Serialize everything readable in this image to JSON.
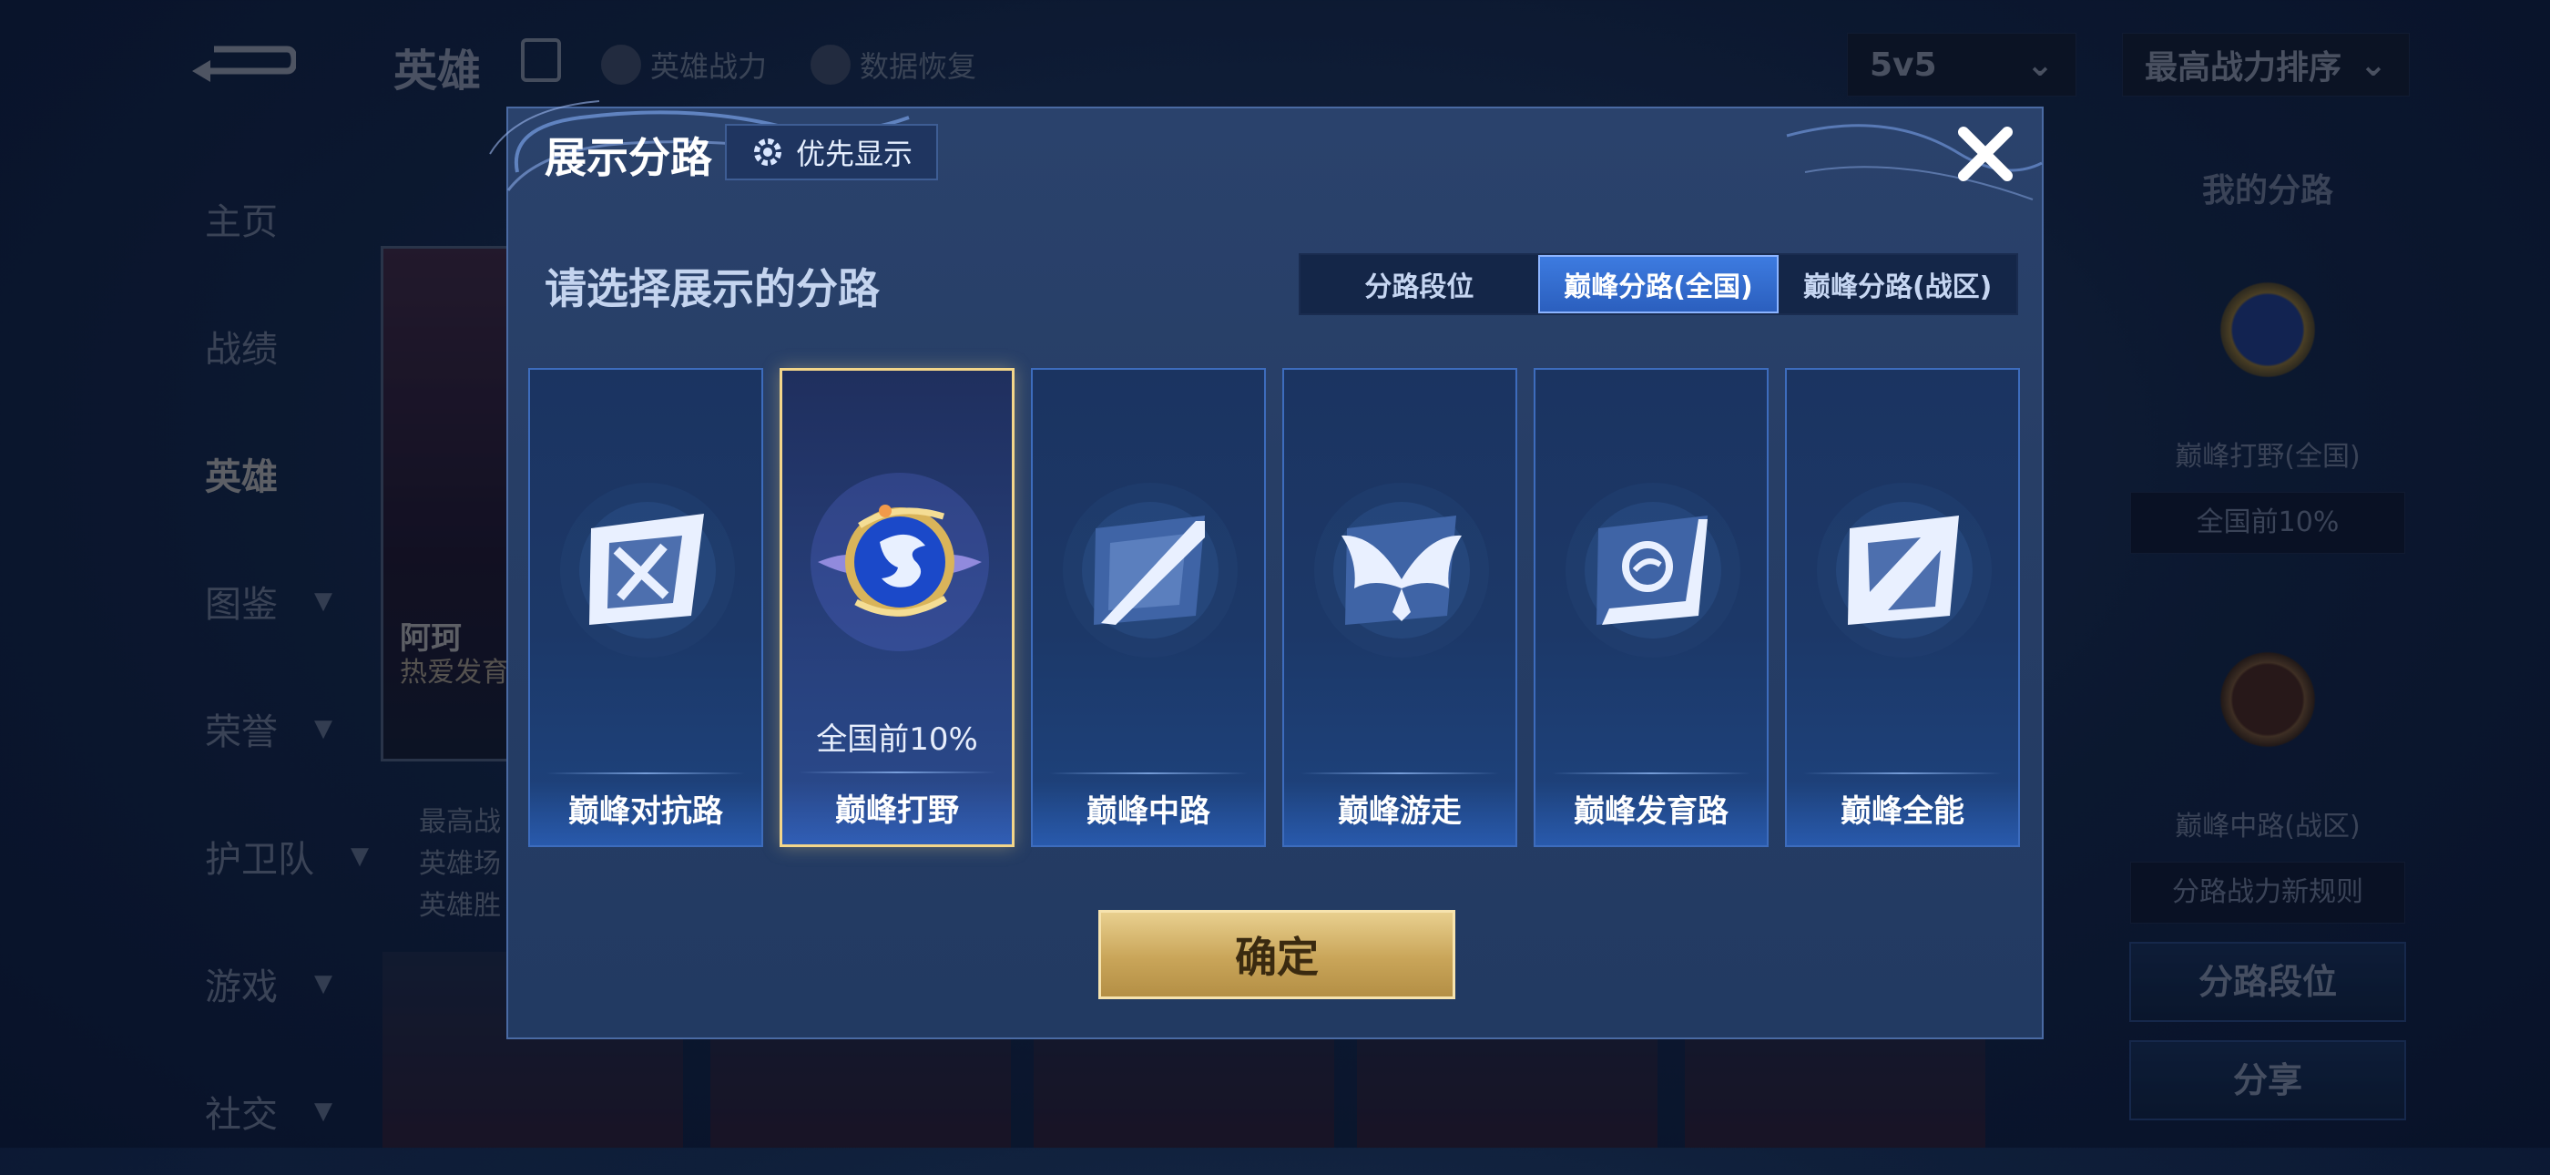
{
  "background": {
    "header_title": "英雄",
    "header_links": [
      "英雄战力",
      "数据恢复"
    ],
    "mode_select": "5v5",
    "sort_select": "最高战力排序",
    "nav_items": [
      {
        "label": "主页",
        "has_chevron": false,
        "active": false
      },
      {
        "label": "战绩",
        "has_chevron": false,
        "active": false
      },
      {
        "label": "英雄",
        "has_chevron": false,
        "active": true
      },
      {
        "label": "图鉴",
        "has_chevron": true,
        "active": false
      },
      {
        "label": "荣誉",
        "has_chevron": true,
        "active": false
      },
      {
        "label": "护卫队",
        "has_chevron": true,
        "active": false
      },
      {
        "label": "游戏",
        "has_chevron": true,
        "active": false
      },
      {
        "label": "社交",
        "has_chevron": true,
        "active": false
      }
    ],
    "hero_card": {
      "name_partial": "阿珂",
      "subtitle_partial": "热爱发育"
    },
    "hero_stats_partial": [
      "最高战",
      "英雄场",
      "英雄胜"
    ],
    "right_panel": {
      "title": "我的分路",
      "badge1_label": "巅峰打野(全国)",
      "badge1_rank": "全国前10%",
      "badge2_label": "巅峰中路(战区)",
      "rule_link": "分路战力新规则",
      "lane_rank_button": "分路段位",
      "share_button": "分享"
    }
  },
  "modal": {
    "title": "展示分路",
    "priority_button": "优先显示",
    "subtitle": "请选择展示的分路",
    "tabs": [
      {
        "label": "分路段位",
        "active": false
      },
      {
        "label": "巅峰分路(全国)",
        "active": true
      },
      {
        "label": "巅峰分路(战区)",
        "active": false
      }
    ],
    "cards": [
      {
        "label": "巅峰对抗路",
        "icon": "sword-lane-icon",
        "selected": false,
        "rank": ""
      },
      {
        "label": "巅峰打野",
        "icon": "jungle-dragon-badge-icon",
        "selected": true,
        "rank": "全国前10%"
      },
      {
        "label": "巅峰中路",
        "icon": "mid-lane-icon",
        "selected": false,
        "rank": ""
      },
      {
        "label": "巅峰游走",
        "icon": "wings-support-icon",
        "selected": false,
        "rank": ""
      },
      {
        "label": "巅峰发育路",
        "icon": "farm-lane-icon",
        "selected": false,
        "rank": ""
      },
      {
        "label": "巅峰全能",
        "icon": "all-round-icon",
        "selected": false,
        "rank": ""
      }
    ],
    "confirm_button": "确定"
  },
  "colors": {
    "accent_gold": "#f3d68a",
    "tab_active": "#3d7be0",
    "modal_bg": "#273e66"
  }
}
